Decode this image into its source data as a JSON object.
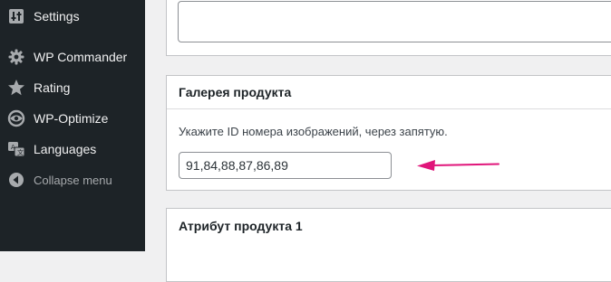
{
  "sidebar": {
    "items": [
      {
        "label": "Settings",
        "icon": "settings-sliders-icon"
      },
      {
        "label": "WP Commander",
        "icon": "gear-icon"
      },
      {
        "label": "Rating",
        "icon": "star-icon"
      },
      {
        "label": "WP-Optimize",
        "icon": "optimize-icon"
      },
      {
        "label": "Languages",
        "icon": "translate-icon"
      },
      {
        "label": "Collapse menu",
        "icon": "collapse-arrow-icon"
      }
    ]
  },
  "gallery": {
    "title": "Галерея продукта",
    "hint": "Укажите ID номера изображений, через запятую.",
    "value": "91,84,88,87,86,89"
  },
  "attribute": {
    "title": "Атрибут продукта 1"
  },
  "colors": {
    "sidebar_bg": "#1d2327",
    "arrow": "#e0157a"
  }
}
